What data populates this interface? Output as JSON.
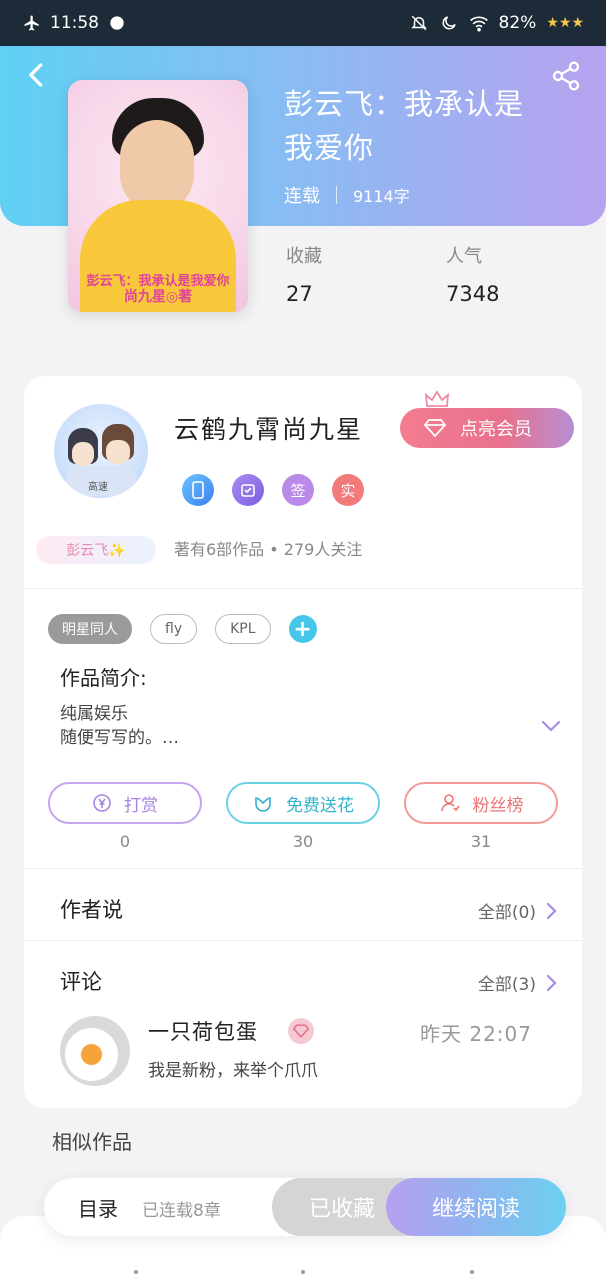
{
  "status_bar": {
    "time": "11:58",
    "battery": "82%"
  },
  "book": {
    "title": "彭云飞：我承认是我爱你",
    "status": "连载",
    "word_count": "9114字",
    "cover_text_line1": "彭云飞：我承认是我爱你",
    "cover_text_line2": "尚九星◎著"
  },
  "stats": [
    {
      "label": "收藏",
      "value": "27"
    },
    {
      "label": "人气",
      "value": "7348"
    }
  ],
  "author": {
    "name": "云鹤九霄尚九星",
    "vip_button": "点亮会员",
    "badges": [
      "",
      "",
      "签",
      "实"
    ],
    "fan_tag": "彭云飞✨",
    "summary": "著有6部作品 • 279人关注",
    "avatar_text": "高速"
  },
  "tags": [
    "明星同人",
    "fly",
    "KPL"
  ],
  "intro": {
    "title": "作品简介:",
    "line1": "纯属娱乐",
    "line2": "随便写写的。…"
  },
  "actions": [
    {
      "label": "打赏",
      "count": "0"
    },
    {
      "label": "免费送花",
      "count": "30"
    },
    {
      "label": "粉丝榜",
      "count": "31"
    }
  ],
  "author_says": {
    "title": "作者说",
    "link": "全部(0)"
  },
  "comments": {
    "title": "评论",
    "link": "全部(3)",
    "items": [
      {
        "user": "一只荷包蛋",
        "time": "昨天 22:07",
        "text": "我是新粉，来举个爪爪"
      }
    ]
  },
  "similar": {
    "title": "相似作品"
  },
  "bottom_bar": {
    "toc": "目录",
    "chapter_count": "已连载8章",
    "fav": "已收藏",
    "read": "继续阅读"
  },
  "colors": {
    "header_gradient_start": "#5fd0f3",
    "header_gradient_end": "#b8a2f0",
    "vip_pink": "#f37c8e",
    "accent_purple": "#a98ce5"
  }
}
